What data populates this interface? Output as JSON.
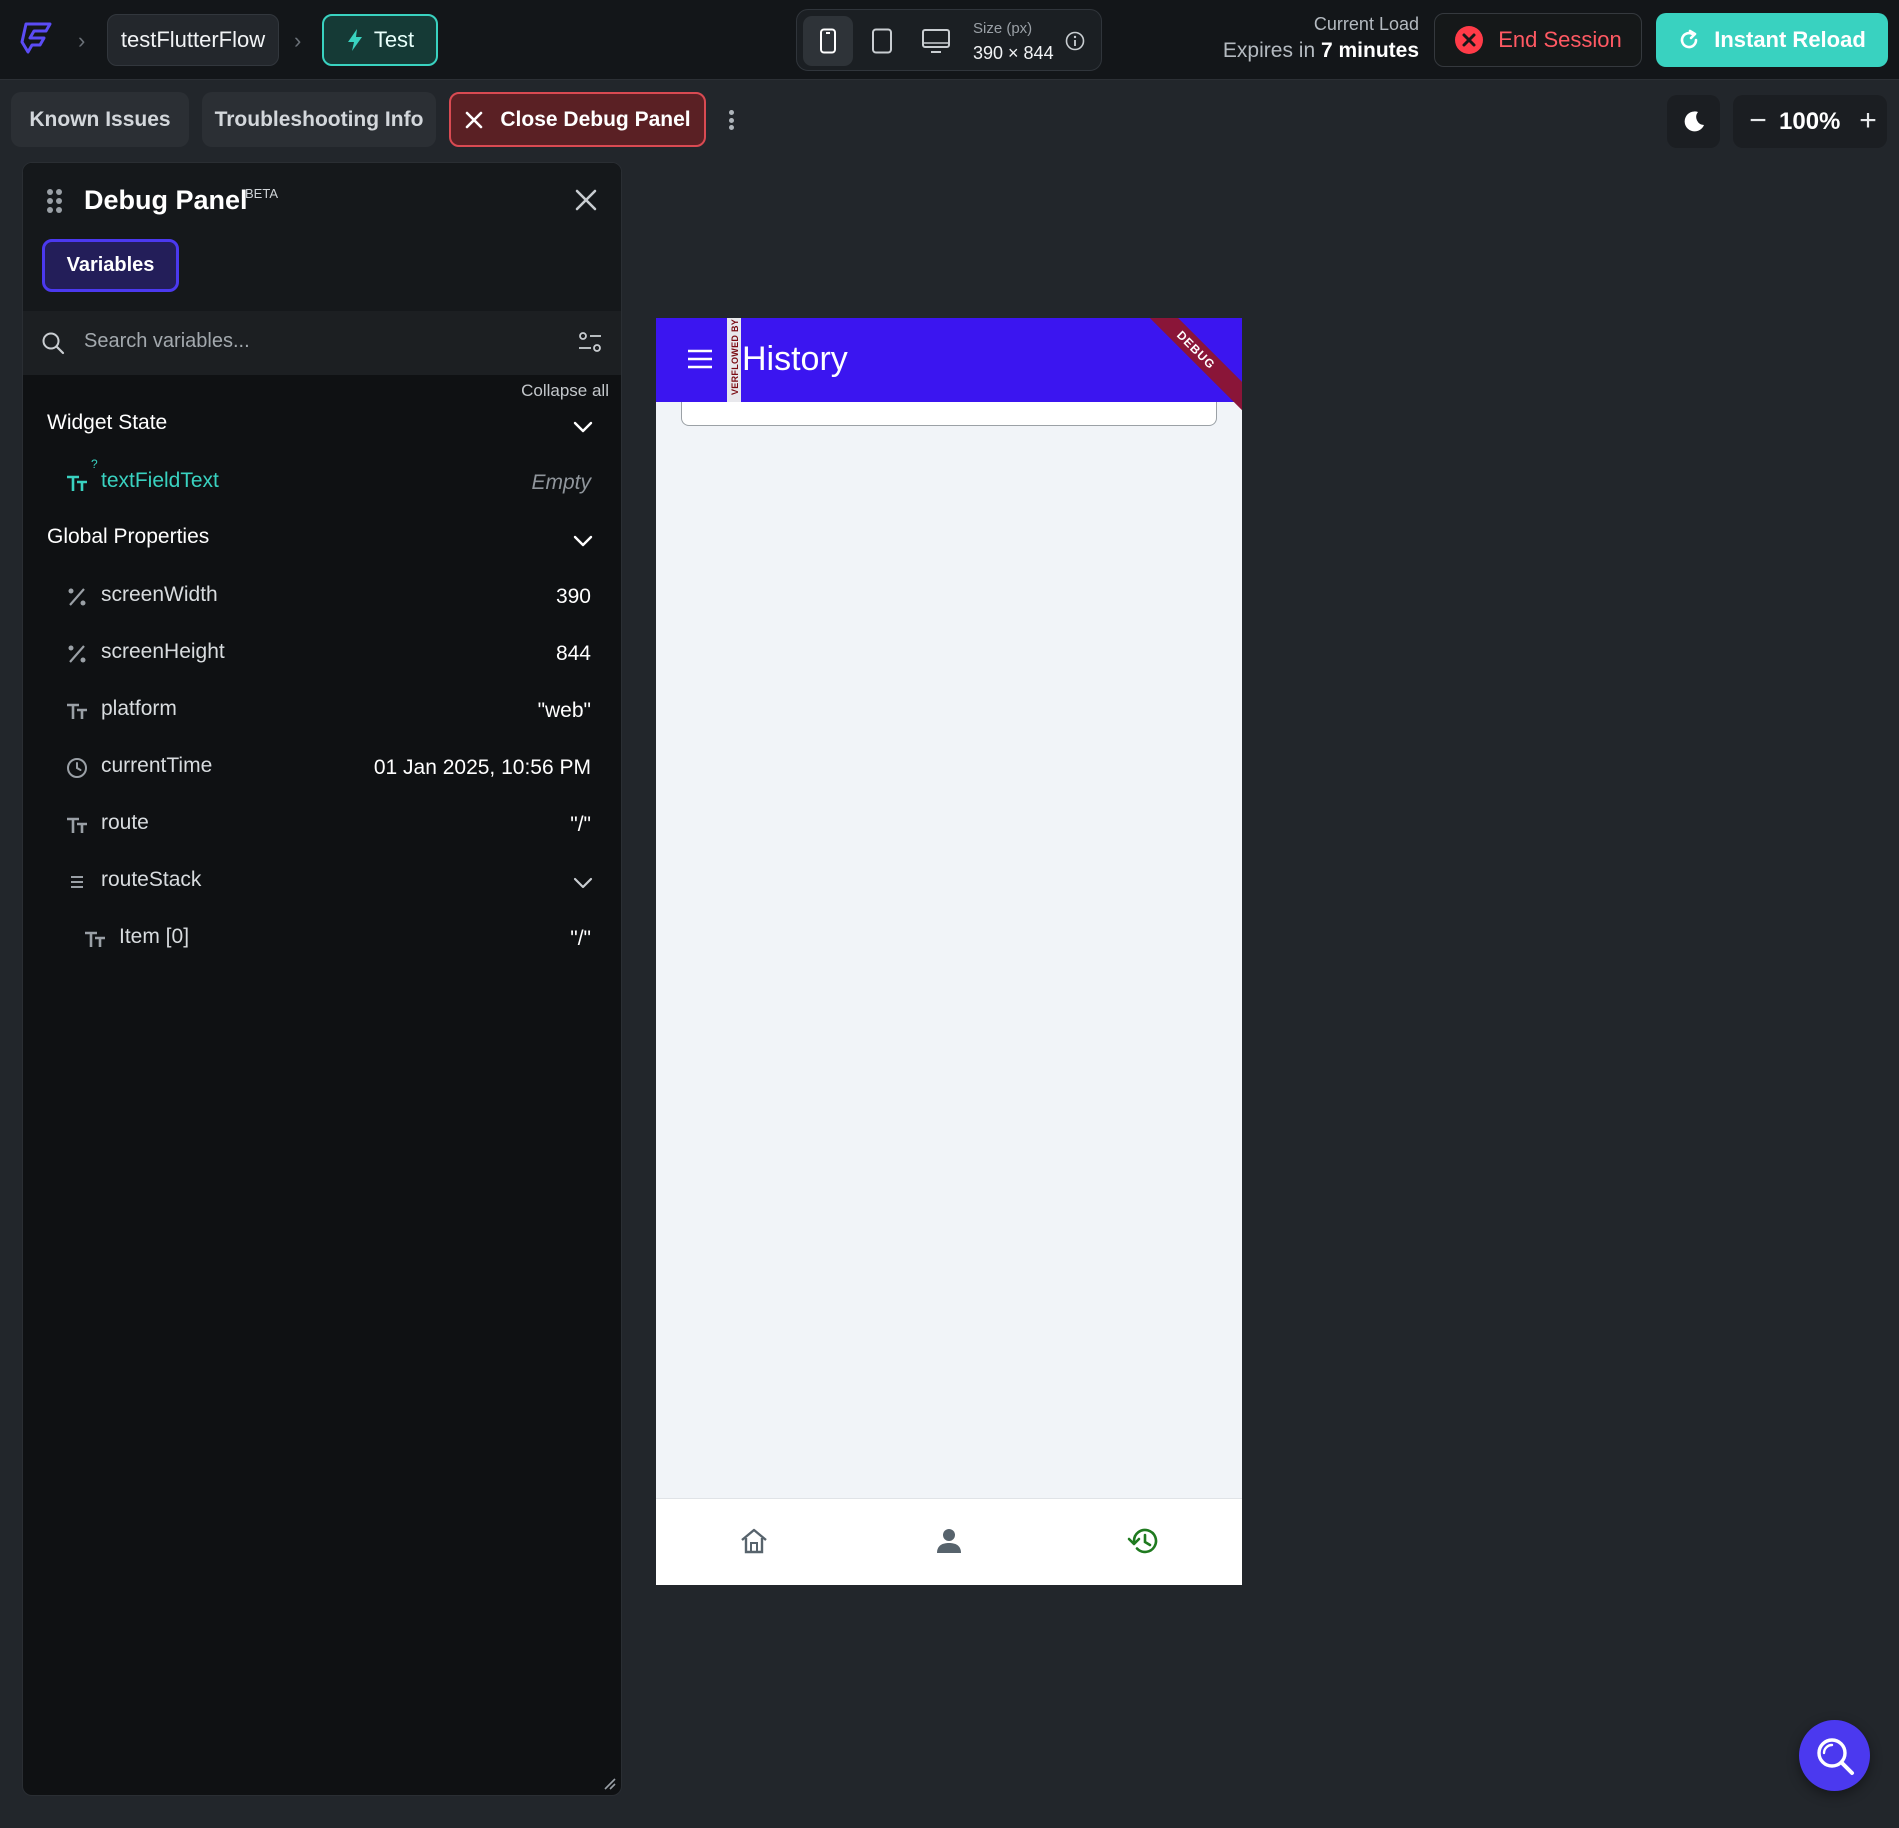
{
  "topbar": {
    "logo_icon": "flutterflow-logo-icon",
    "project_name": "testFlutterFlow",
    "mode_label": "Test",
    "size_label": "Size (px)",
    "size_value": "390 × 844",
    "load_label": "Current Load",
    "expires_prefix": "Expires in ",
    "expires_value": "7 minutes",
    "end_session_label": "End Session",
    "instant_reload_label": "Instant Reload",
    "accent_color": "#39d2c0",
    "danger_color": "#ff5963"
  },
  "toolbar": {
    "known_issues_label": "Known Issues",
    "troubleshooting_label": "Troubleshooting Info",
    "close_debug_label": "Close Debug Panel",
    "zoom_value": "100%",
    "zoom_minus": "−",
    "zoom_plus": "+"
  },
  "debug_panel": {
    "title": "Debug Panel",
    "badge": "BETA",
    "variables_tab": "Variables",
    "search_placeholder": "Search variables...",
    "collapse_all": "Collapse all",
    "widget_state": {
      "label": "Widget State",
      "items": [
        {
          "name": "textFieldText",
          "value": "Empty",
          "icon": "text-type-icon",
          "optional_marker": "?"
        }
      ]
    },
    "global_properties": {
      "label": "Global Properties",
      "items": [
        {
          "name": "screenWidth",
          "value": "390",
          "icon": "number-percent-icon"
        },
        {
          "name": "screenHeight",
          "value": "844",
          "icon": "number-percent-icon"
        },
        {
          "name": "platform",
          "value": "\"web\"",
          "icon": "text-type-icon"
        },
        {
          "name": "currentTime",
          "value": "01 Jan 2025, 10:56 PM",
          "icon": "clock-icon"
        },
        {
          "name": "route",
          "value": "\"/\"",
          "icon": "text-type-icon"
        },
        {
          "name": "routeStack",
          "value": "",
          "icon": "list-icon"
        },
        {
          "name": "Item [0]",
          "value": "\"/\"",
          "icon": "text-type-icon"
        }
      ]
    }
  },
  "phone": {
    "appbar_title": "History",
    "overflow_text": "VERFLOWED BY 7",
    "debug_banner": "DEBUG",
    "appbar_color": "#3b15f0",
    "nav_items": [
      "home-icon",
      "person-icon",
      "history-icon"
    ],
    "nav_active_color": "#1f7a1f"
  }
}
